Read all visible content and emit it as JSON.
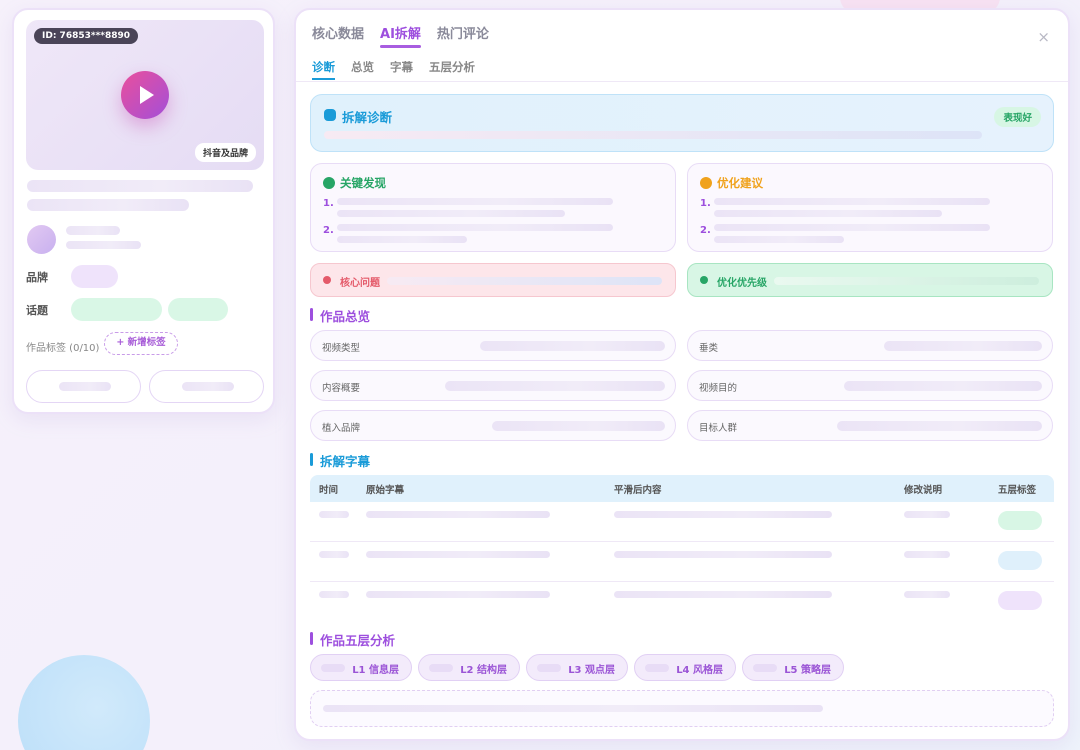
{
  "video": {
    "id_label": "ID: 76853***8890",
    "platform_badge": "抖音及品牌"
  },
  "left": {
    "brand_label": "品牌",
    "topic_label": "话题",
    "tags_label": "作品标签 (0/10)",
    "new_tag_button": "+ 新增标签"
  },
  "tabs": {
    "main": [
      "核心数据",
      "AI拆解",
      "热门评论"
    ],
    "sub": [
      "诊断",
      "总览",
      "字幕",
      "五层分析"
    ],
    "close": "×"
  },
  "diagnosis": {
    "title": "拆解诊断",
    "badge": "表现好"
  },
  "findings": {
    "title": "关键发现",
    "items": [
      "1.",
      "2."
    ]
  },
  "suggestions": {
    "title": "优化建议",
    "items": [
      "1.",
      "2."
    ]
  },
  "issue": {
    "core": "核心问题",
    "priority": "优化优先级"
  },
  "overview": {
    "title": "作品总览",
    "fields": [
      "视频类型",
      "垂类",
      "内容概要",
      "视频目的",
      "植入品牌",
      "目标人群"
    ]
  },
  "subtitles": {
    "title": "拆解字幕",
    "headers": [
      "时间",
      "原始字幕",
      "平滑后内容",
      "修改说明",
      "五层标签"
    ]
  },
  "layers": {
    "title": "作品五层分析",
    "items": [
      "L1 信息层",
      "L2 结构层",
      "L3 观点层",
      "L4 风格层",
      "L5 策略层"
    ]
  },
  "colors": {
    "accent": "#9d4fde",
    "blue": "#1a9bd8",
    "green": "#27a566",
    "orange": "#f0a21c",
    "red": "#e45a6a"
  }
}
